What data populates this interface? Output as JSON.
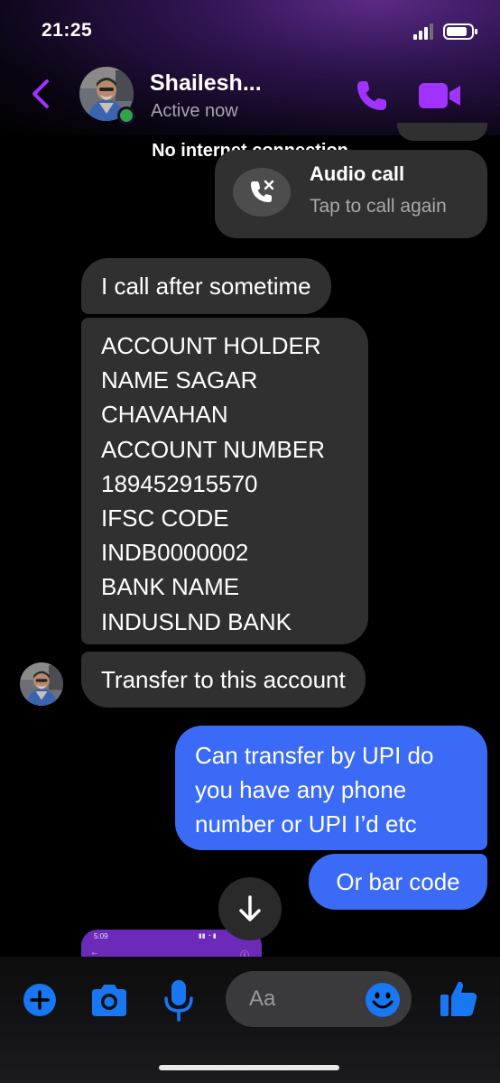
{
  "status_bar": {
    "time": "21:25"
  },
  "header": {
    "contact_name": "Shailesh...",
    "contact_status": "Active now"
  },
  "banner": {
    "no_internet": "No internet connection"
  },
  "audio_call": {
    "title": "Audio call",
    "subtitle": "Tap to call again"
  },
  "messages": [
    {
      "direction": "in",
      "text": "I call after sometime"
    },
    {
      "direction": "in",
      "lines": [
        "ACCOUNT HOLDER",
        "NAME SAGAR",
        "CHAVAHAN",
        "ACCOUNT NUMBER",
        "189452915570",
        "IFSC CODE",
        "INDB0000002",
        "BANK NAME",
        "INDUSLND BANK"
      ]
    },
    {
      "direction": "in",
      "text": "Transfer to this account"
    },
    {
      "direction": "out",
      "lines": [
        "Can transfer by UPI do",
        "you have any phone",
        "number or UPI I’d etc"
      ]
    },
    {
      "direction": "out",
      "text": "Or bar code"
    }
  ],
  "attachment_preview": {
    "time": "5:09"
  },
  "composer": {
    "placeholder": "Aa"
  },
  "colors": {
    "accent_purple": "#a033ff",
    "sent_bubble": "#3b6bf6",
    "received_bubble": "#303030",
    "composer_icon_blue": "#1877f2",
    "active_dot": "#31a24c"
  },
  "icons": {
    "back": "chevron-left-icon",
    "call": "phone-icon",
    "video": "video-camera-icon",
    "missed_call": "phone-missed-icon",
    "scroll": "arrow-down-icon",
    "add": "plus-circle-icon",
    "camera": "camera-icon",
    "mic": "microphone-icon",
    "emoji": "smiley-icon",
    "like": "thumbs-up-icon"
  }
}
